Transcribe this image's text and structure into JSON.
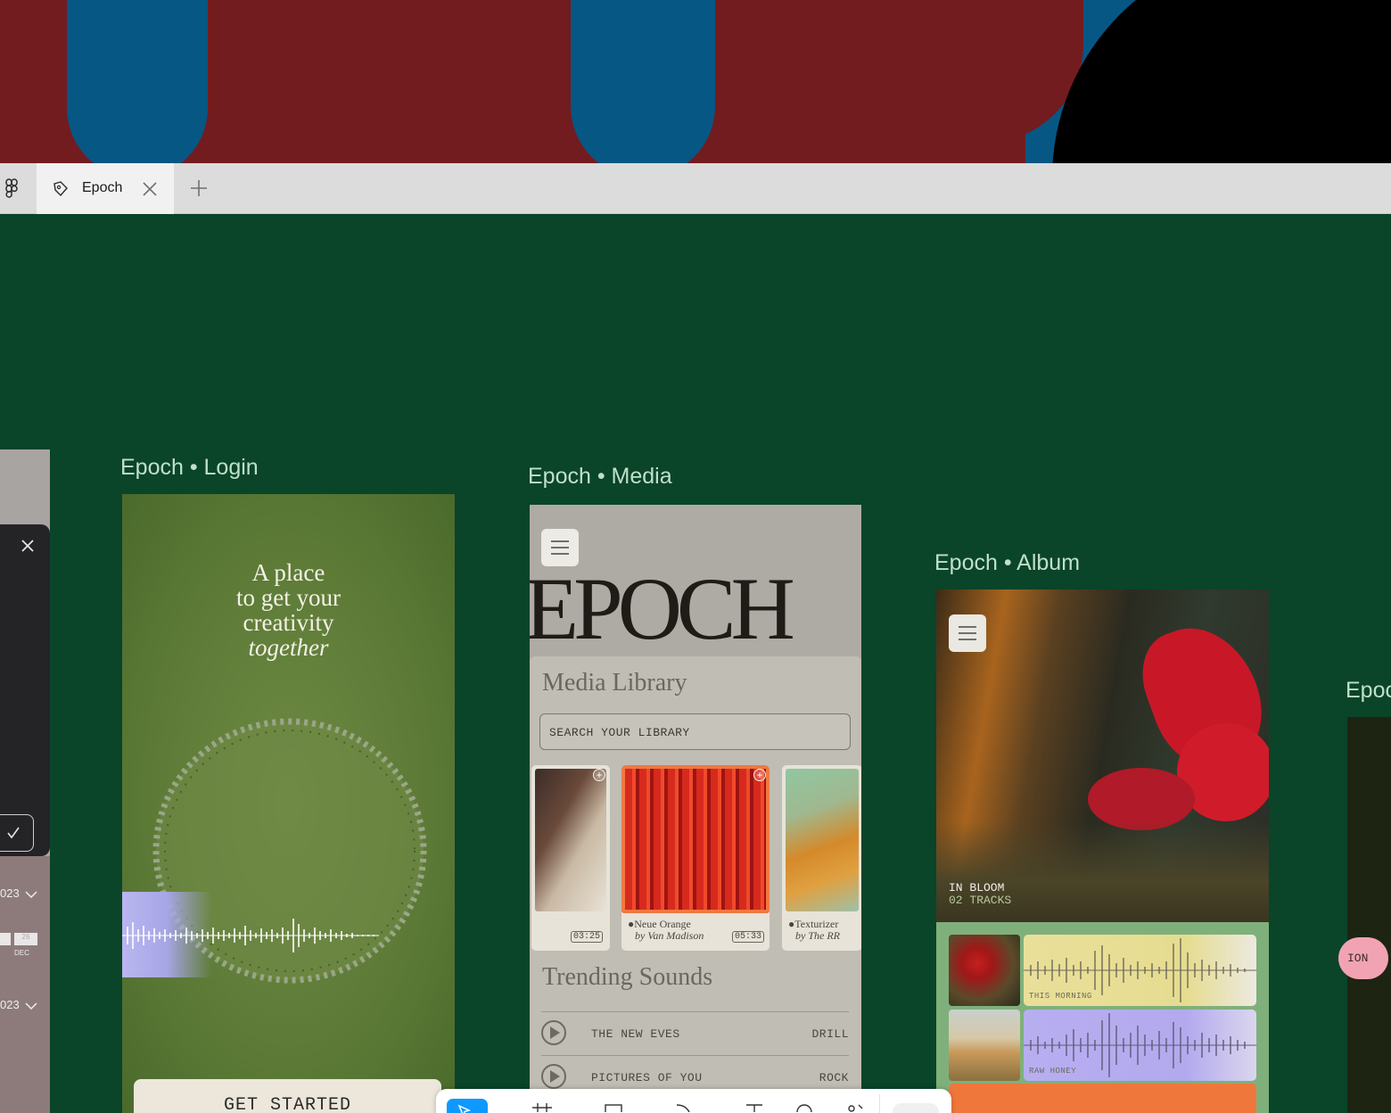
{
  "tab_bar": {
    "tab_title": "Epoch"
  },
  "frames": {
    "login": {
      "label": "Epoch • Login",
      "tagline_lines": [
        "A place",
        "to get your",
        "creativity"
      ],
      "tagline_italic": "together",
      "button": "GET STARTED"
    },
    "media": {
      "label": "Epoch • Media",
      "wordmark": "EPOCH",
      "library_title": "Media Library",
      "search_placeholder": "SEARCH YOUR LIBRARY",
      "cards": [
        {
          "title": "",
          "artist": "",
          "duration": "03:25"
        },
        {
          "title": "Neue Orange",
          "artist": "by Van Madison",
          "duration": "05:33"
        },
        {
          "title": "Texturizer",
          "artist": "by The RR",
          "duration": ""
        }
      ],
      "trending_title": "Trending Sounds",
      "tracks": [
        {
          "name": "THE NEW EVES",
          "genre": "DRILL"
        },
        {
          "name": "PICTURES OF YOU",
          "genre": "ROCK"
        }
      ]
    },
    "album": {
      "label": "Epoch • Album",
      "name": "IN BLOOM",
      "track_count": "02 TRACKS",
      "tracks": [
        {
          "name": "THIS MORNING",
          "color": "#e9df9a"
        },
        {
          "name": "RAW HONEY",
          "color": "#b7aef0"
        }
      ]
    },
    "next": {
      "label": "Epoc",
      "pill": "ION"
    },
    "left_partial": {
      "year_1": "023",
      "date_1": "26",
      "month_1": "DEC",
      "year_2": "023"
    }
  },
  "colors": {
    "canvas": "#0a4429",
    "accent_blue": "#0d99ff",
    "label": "#bfe0c9"
  },
  "icons": {
    "figma": "figma-logo-icon",
    "tab": "figma-file-icon",
    "close": "close-icon",
    "add": "plus-icon",
    "menu": "hamburger-icon",
    "play": "play-icon",
    "check": "check-icon",
    "chevron": "chevron-down-icon"
  }
}
